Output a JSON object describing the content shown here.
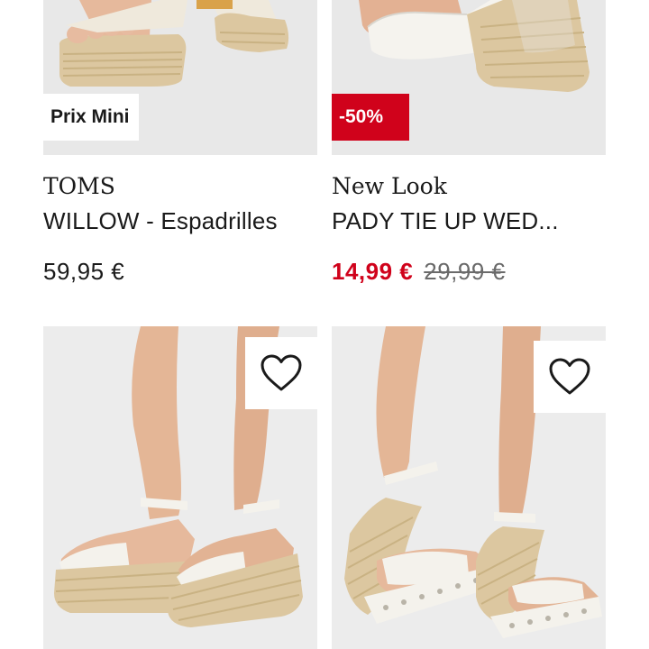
{
  "products": [
    {
      "badge": "Prix Mini",
      "brand": "TOMS",
      "name": "WILLOW - Espadrilles",
      "price": "59,95 €"
    },
    {
      "badge": "-50%",
      "brand": "New Look",
      "name": "PADY TIE UP WED...",
      "sale_price": "14,99 €",
      "old_price": "29,99 €"
    },
    {
      "wishlist_icon": "heart-outline-icon"
    },
    {
      "wishlist_icon": "heart-outline-icon"
    }
  ],
  "colors": {
    "sale_red": "#d0021b",
    "text": "#1a1a1a",
    "old_price": "#6a6a6a",
    "image_bg": "#e9e9e9"
  }
}
